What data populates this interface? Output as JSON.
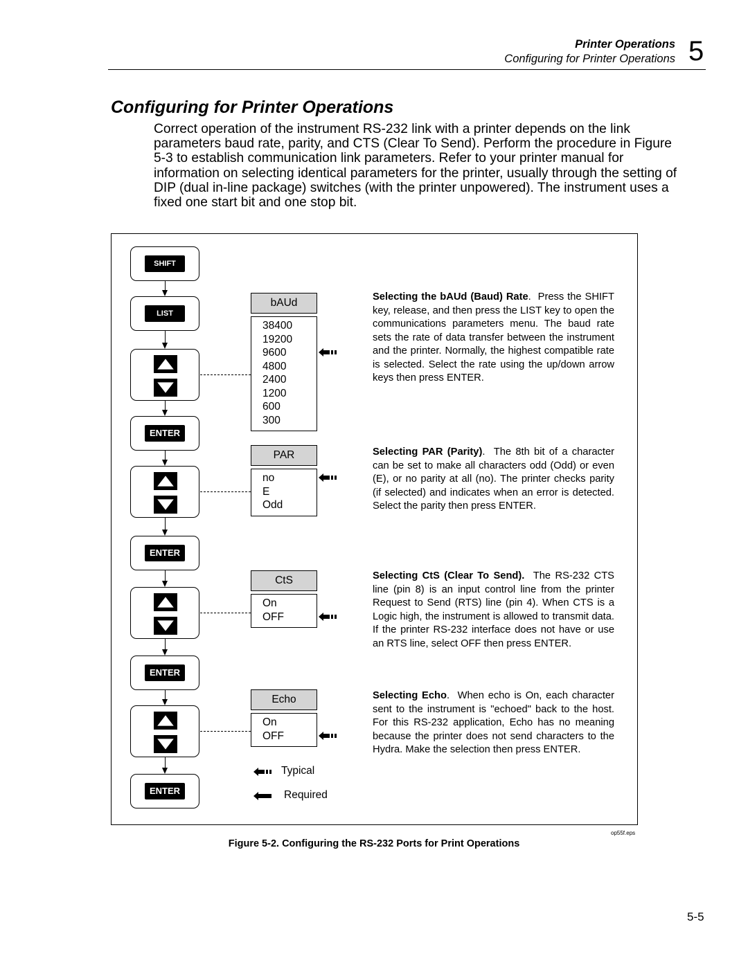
{
  "header": {
    "section": "Printer Operations",
    "subsection": "Configuring for Printer Operations",
    "chapter_number": "5"
  },
  "page_title": "Configuring for Printer Operations",
  "intro": "Correct operation of the instrument RS-232 link with a printer depends on the link parameters baud rate, parity, and CTS (Clear To Send). Perform the procedure in Figure 5-3 to establish communication link parameters. Refer to your printer manual for information on selecting identical parameters for the printer, usually through the setting of DIP (dual in-line package) switches (with the printer unpowered). The instrument uses a fixed one start bit and one stop bit.",
  "keys": {
    "shift": "SHIFT",
    "list": "LIST",
    "enter": "ENTER"
  },
  "menus": [
    {
      "title": "bAUd",
      "options": [
        "38400",
        "19200",
        "9600",
        "4800",
        "2400",
        "1200",
        "600",
        "300"
      ],
      "typical_index": 2
    },
    {
      "title": "PAR",
      "options": [
        "no",
        "E",
        "Odd"
      ],
      "typical_index": 0
    },
    {
      "title": "CtS",
      "options": [
        "On",
        "OFF"
      ],
      "typical_index": 1
    },
    {
      "title": "Echo",
      "options": [
        "On",
        "OFF"
      ],
      "typical_index": 1
    }
  ],
  "descriptions": [
    {
      "heading": "Selecting the bAUd (Baud) Rate",
      "sep": ".  ",
      "text": "Press the SHIFT key, release, and then press the LIST key to open the communications parameters menu. The baud rate sets the rate of data transfer between the instrument and the printer. Normally, the highest compatible rate is selected. Select the rate using the up/down arrow keys then press ENTER."
    },
    {
      "heading": "Selecting PAR (Parity)",
      "sep": ".  ",
      "text": "The 8th bit of a character can be set to make all characters odd (Odd) or even (E), or no parity at all (no).  The printer checks parity (if selected) and indicates when an error is detected.  Select the parity then press ENTER."
    },
    {
      "heading": "Selecting CtS (Clear To Send).",
      "sep": "  ",
      "text": "The RS-232 CTS line (pin 8) is an input control line from the printer Request to Send (RTS) line (pin 4).  When CTS is a Logic high, the instrument is allowed to transmit data.  If the printer RS-232 interface does not have or use an RTS line, select OFF then press ENTER."
    },
    {
      "heading": "Selecting Echo",
      "sep": ".  ",
      "text": "When echo is On, each character sent to the instrument is \"echoed\" back to the host.  For this RS-232 application, Echo has no meaning because the printer does not send characters to the Hydra.  Make the selection then press ENTER."
    }
  ],
  "legend": {
    "typical": "Typical",
    "required": "Required"
  },
  "figure_file": "op55f.eps",
  "caption": "Figure 5-2. Configuring the RS-232 Ports for Print Operations",
  "page_number": "5-5"
}
